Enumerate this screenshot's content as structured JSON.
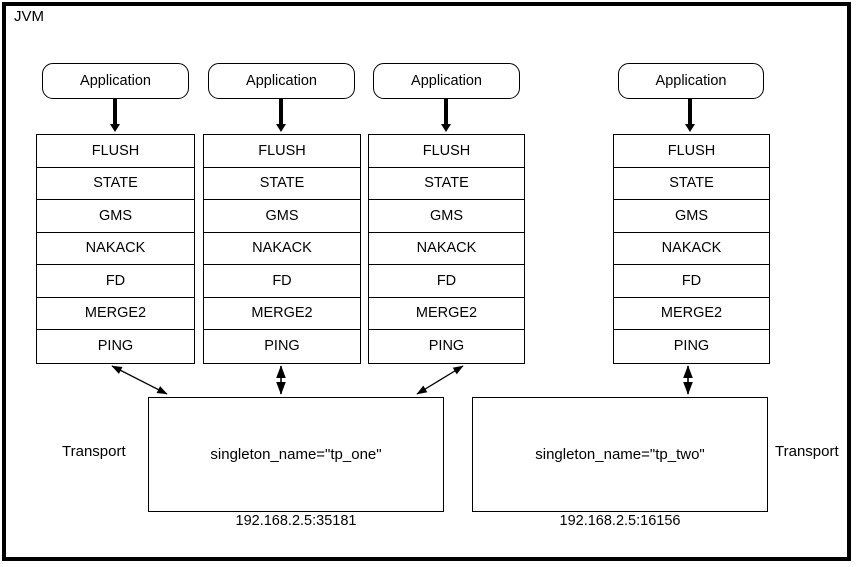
{
  "diagram": {
    "container_label": "JVM",
    "applications": [
      {
        "label": "Application"
      },
      {
        "label": "Application"
      },
      {
        "label": "Application"
      },
      {
        "label": "Application"
      }
    ],
    "protocol_stacks": [
      {
        "id": "stack-1",
        "protocols": [
          "FLUSH",
          "STATE",
          "GMS",
          "NAKACK",
          "FD",
          "MERGE2",
          "PING"
        ]
      },
      {
        "id": "stack-2",
        "protocols": [
          "FLUSH",
          "STATE",
          "GMS",
          "NAKACK",
          "FD",
          "MERGE2",
          "PING"
        ]
      },
      {
        "id": "stack-3",
        "protocols": [
          "FLUSH",
          "STATE",
          "GMS",
          "NAKACK",
          "FD",
          "MERGE2",
          "PING"
        ]
      },
      {
        "id": "stack-4",
        "protocols": [
          "FLUSH",
          "STATE",
          "GMS",
          "NAKACK",
          "FD",
          "MERGE2",
          "PING"
        ]
      }
    ],
    "transports": [
      {
        "id": "transport-one",
        "side_label": "Transport",
        "singleton": "singleton_name=\"tp_one\"",
        "address": "192.168.2.5:35181"
      },
      {
        "id": "transport-two",
        "side_label": "Transport",
        "singleton": "singleton_name=\"tp_two\"",
        "address": "192.168.2.5:16156"
      }
    ],
    "colors": {
      "stroke": "#000000",
      "background": "#ffffff"
    }
  }
}
